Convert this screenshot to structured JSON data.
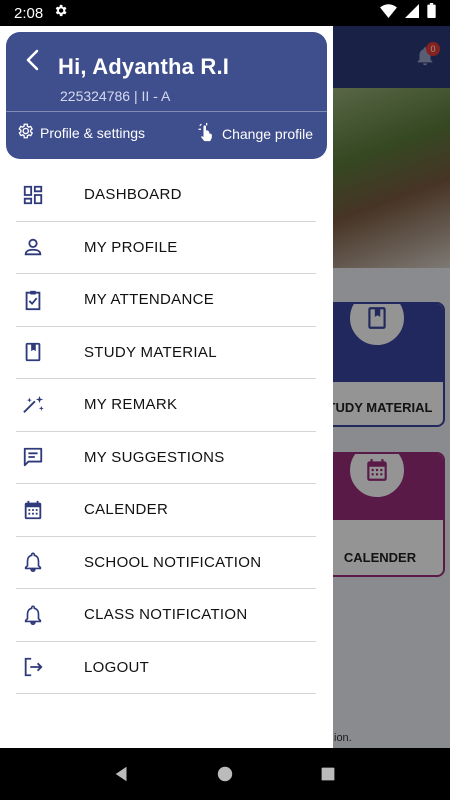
{
  "status_bar": {
    "time": "2:08",
    "icons": [
      "gear-icon",
      "wifi-icon",
      "signal-icon",
      "battery-icon"
    ]
  },
  "background_app": {
    "notification_count": "0",
    "cards": [
      {
        "label": "TUDY MATERIAL",
        "color": "#3a46a0"
      },
      {
        "label": "CALENDER",
        "color": "#9b2d7c"
      }
    ],
    "footer_text": "ion."
  },
  "drawer": {
    "header": {
      "greeting": "Hi, Adyantha R.I",
      "subtitle": "225324786  |  II - A",
      "profile_settings": "Profile & settings",
      "change_profile": "Change profile",
      "bg_color": "#3f4e8c"
    },
    "menu": [
      {
        "label": "DASHBOARD",
        "icon": "dashboard-icon"
      },
      {
        "label": "MY PROFILE",
        "icon": "person-icon"
      },
      {
        "label": "MY ATTENDANCE",
        "icon": "clipboard-check-icon"
      },
      {
        "label": "STUDY MATERIAL",
        "icon": "book-icon"
      },
      {
        "label": "MY REMARK",
        "icon": "sparkle-icon"
      },
      {
        "label": "MY SUGGESTIONS",
        "icon": "chat-icon"
      },
      {
        "label": "CALENDER",
        "icon": "calendar-icon"
      },
      {
        "label": "SCHOOL NOTIFICATION",
        "icon": "bell-icon"
      },
      {
        "label": "CLASS NOTIFICATION",
        "icon": "bell-icon"
      },
      {
        "label": "LOGOUT",
        "icon": "logout-icon"
      }
    ]
  },
  "colors": {
    "accent": "#2e3a7a",
    "icon": "#2e3a7a"
  }
}
